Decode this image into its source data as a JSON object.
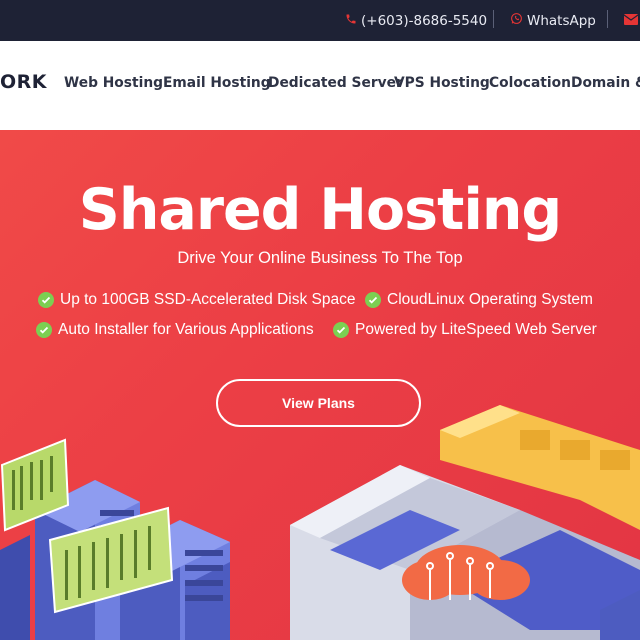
{
  "topbar": {
    "phone": "(+603)-8686-5540",
    "whatsapp": "WhatsApp",
    "icons": [
      "phone-icon",
      "whatsapp-icon",
      "mail-icon"
    ]
  },
  "brand": {
    "logo_text": "ORK"
  },
  "nav": {
    "items": [
      "Web Hosting",
      "Email Hosting",
      "Dedicated Server",
      "VPS Hosting",
      "Colocation",
      "Domain &"
    ]
  },
  "hero": {
    "title": "Shared Hosting",
    "subtitle": "Drive Your Online Business To The Top",
    "features": [
      "Up to 100GB SSD-Accelerated Disk Space",
      "CloudLinux Operating System",
      "Auto Installer for Various Applications",
      "Powered by LiteSpeed Web Server"
    ],
    "cta": "View Plans"
  },
  "colors": {
    "topbar_bg": "#1e2235",
    "hero_red": "#ec3f45",
    "check_green": "#7ccf52",
    "accent_red": "#e53535"
  }
}
